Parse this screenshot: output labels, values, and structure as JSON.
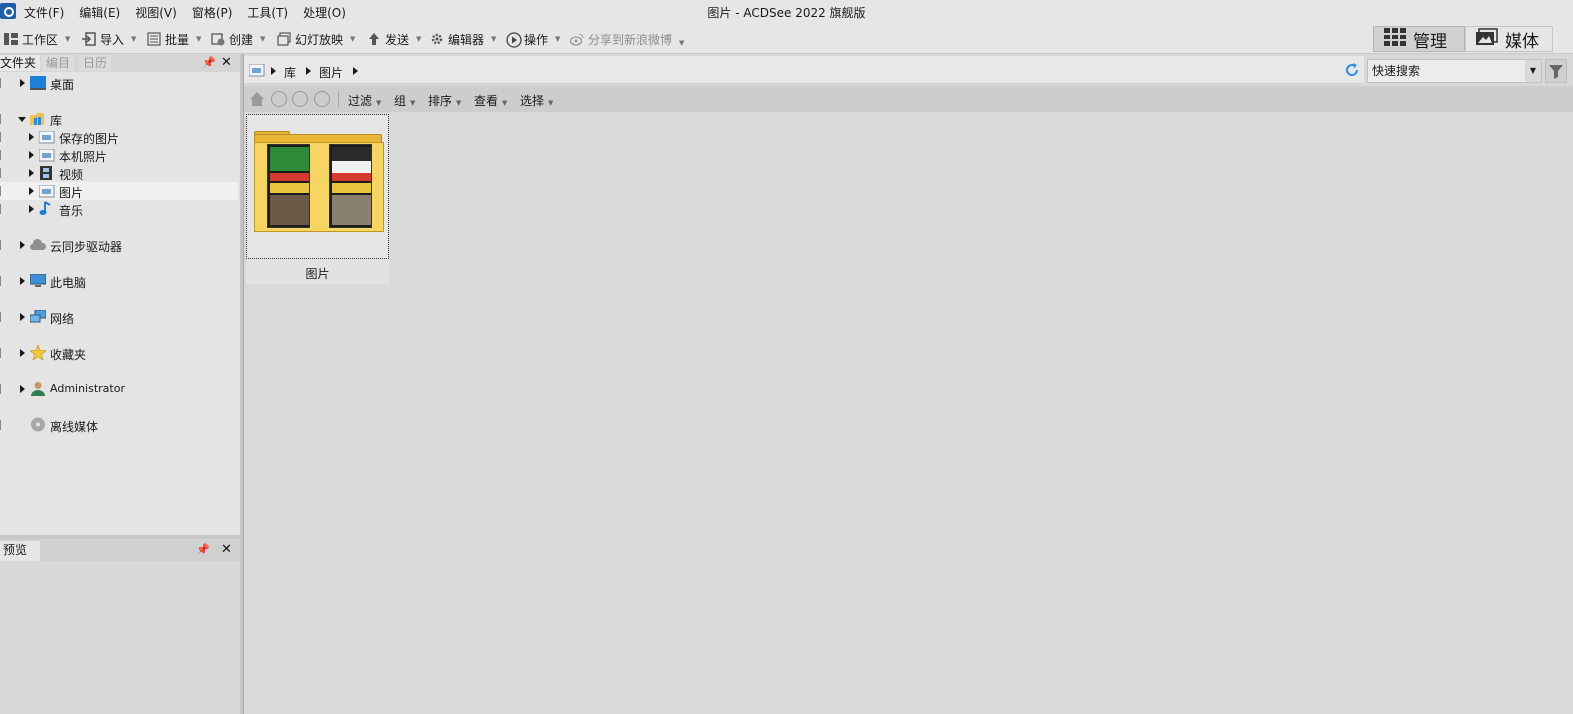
{
  "window": {
    "title": "图片 - ACDSee 2022 旗舰版"
  },
  "menu": [
    "文件(F)",
    "编辑(E)",
    "视图(V)",
    "窗格(P)",
    "工具(T)",
    "处理(O)"
  ],
  "toolbar": {
    "workspace": "工作区",
    "import": "导入",
    "batch": "批量",
    "create": "创建",
    "slideshow": "幻灯放映",
    "send": "发送",
    "editor": "编辑器",
    "actions": "操作",
    "share_weibo": "分享到新浪微博"
  },
  "modes": {
    "manage": "管理",
    "media": "媒体"
  },
  "panel_tabs": {
    "folders": "文件夹",
    "catalog": "编目",
    "calendar": "日历"
  },
  "tree": {
    "desktop": "桌面",
    "library": "库",
    "saved_pictures": "保存的图片",
    "camera_roll": "本机照片",
    "videos": "视频",
    "pictures": "图片",
    "music": "音乐",
    "cloud_drives": "云同步驱动器",
    "this_pc": "此电脑",
    "network": "网络",
    "favorites": "收藏夹",
    "administrator": "Administrator",
    "offline_media": "离线媒体"
  },
  "preview": {
    "title": "预览"
  },
  "path": {
    "segments": [
      "库",
      "图片"
    ]
  },
  "search": {
    "placeholder": "快速搜索"
  },
  "subtoolbar": {
    "filter": "过滤",
    "group": "组",
    "sort": "排序",
    "view": "查看",
    "select": "选择"
  },
  "files": [
    {
      "name": "图片",
      "type": "folder"
    }
  ]
}
